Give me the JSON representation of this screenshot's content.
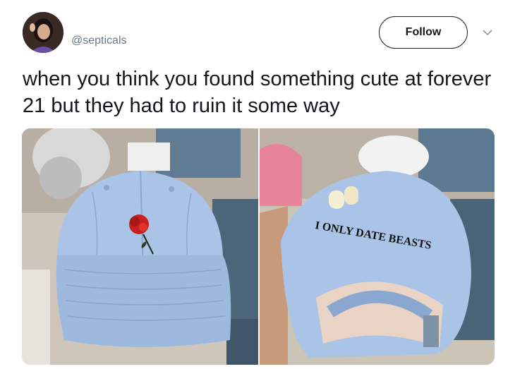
{
  "tweet": {
    "handle": "@septicals",
    "follow_label": "Follow",
    "text": "when you think you found something cute at forever 21 but they had to ruin it some way",
    "avatar_icon": "user-avatar",
    "caret_icon": "chevron-down-icon"
  },
  "photos": {
    "left": {
      "subject": "light blue cap front with embroidered rose"
    },
    "right": {
      "subject": "light blue cap back",
      "embroidery_text": "I ONLY DATE BEASTS"
    }
  },
  "colors": {
    "cap_blue": "#a9c4e6",
    "cap_shadow": "#8aa8cf",
    "rose_red": "#c8201e",
    "text_dark": "#14171a",
    "handle_gray": "#657786"
  }
}
